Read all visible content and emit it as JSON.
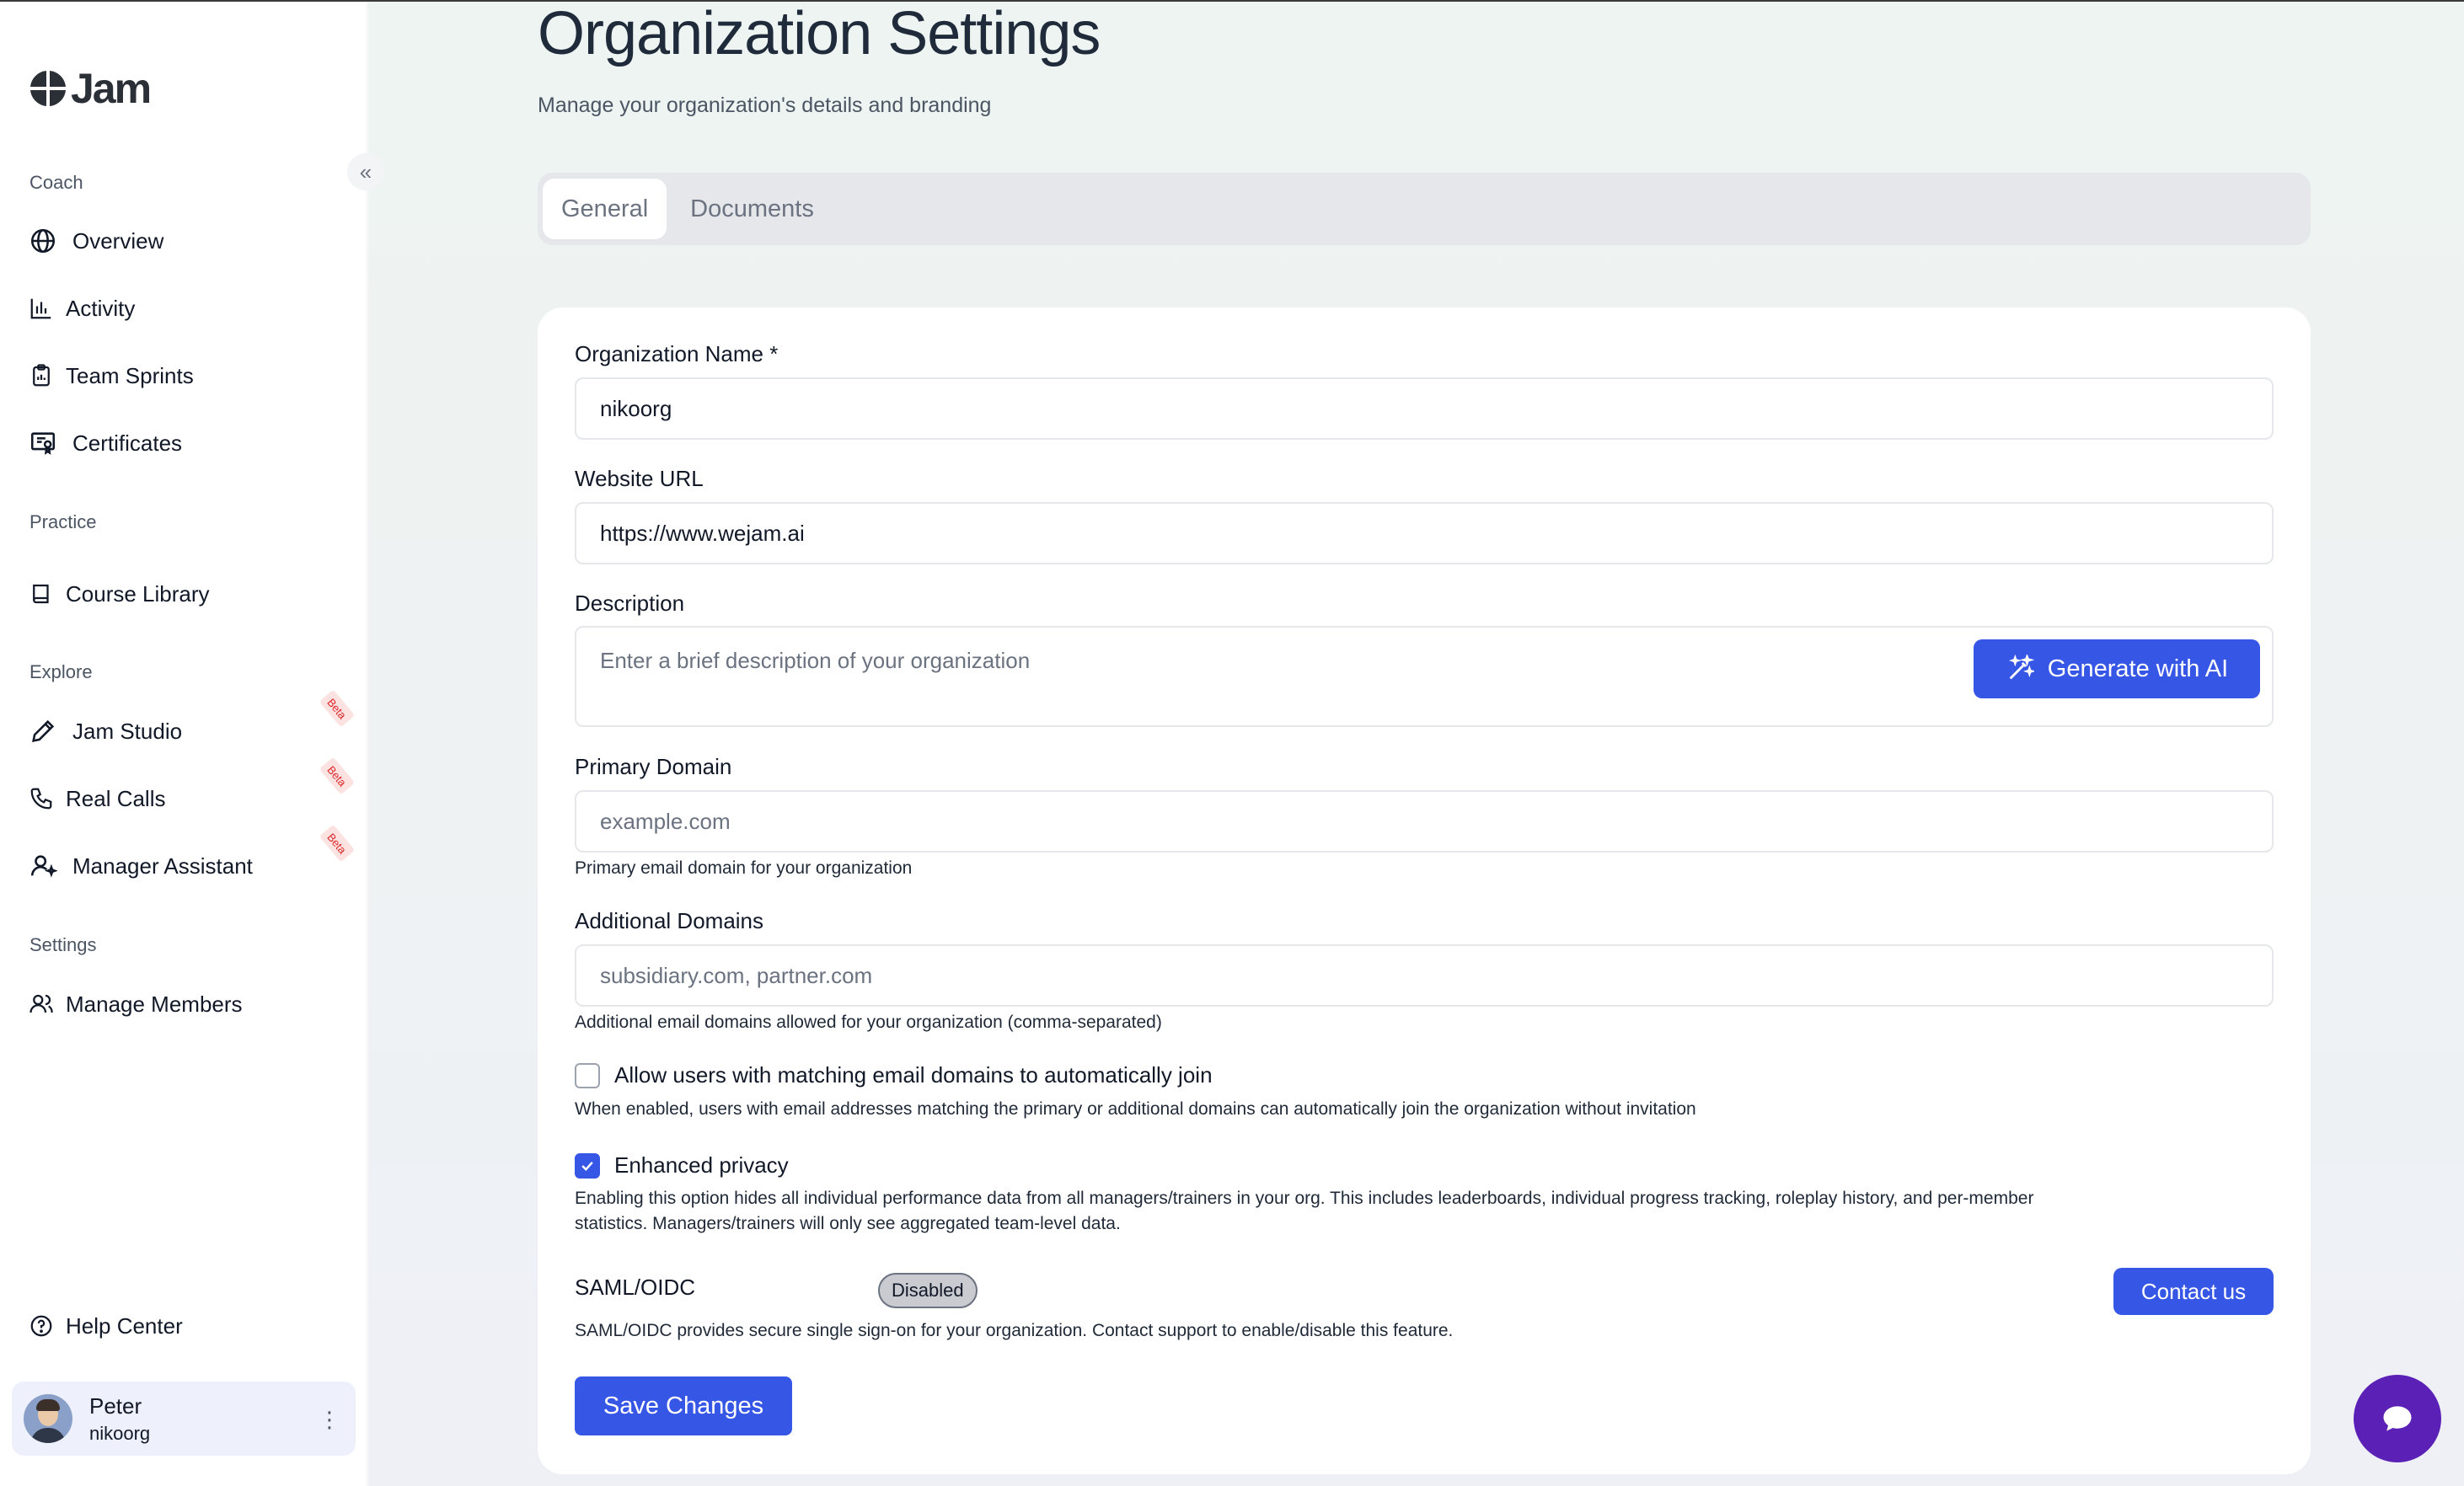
{
  "app": {
    "logo_text": "Jam"
  },
  "sidebar": {
    "sections": [
      {
        "label": "Coach",
        "items": [
          {
            "label": "Overview",
            "icon": "globe-icon"
          },
          {
            "label": "Activity",
            "icon": "bar-chart-icon"
          },
          {
            "label": "Team Sprints",
            "icon": "clipboard-icon"
          },
          {
            "label": "Certificates",
            "icon": "certificate-icon"
          }
        ]
      },
      {
        "label": "Practice",
        "items": [
          {
            "label": "Course Library",
            "icon": "book-icon"
          }
        ]
      },
      {
        "label": "Explore",
        "items": [
          {
            "label": "Jam Studio",
            "icon": "pencil-icon",
            "badge": "Beta"
          },
          {
            "label": "Real Calls",
            "icon": "phone-icon",
            "badge": "Beta"
          },
          {
            "label": "Manager Assistant",
            "icon": "user-sparkle-icon",
            "badge": "Beta"
          }
        ]
      },
      {
        "label": "Settings",
        "items": [
          {
            "label": "Manage Members",
            "icon": "users-icon"
          }
        ]
      }
    ],
    "help_center": "Help Center",
    "user": {
      "name": "Peter",
      "org": "nikoorg"
    }
  },
  "page": {
    "title": "Organization Settings",
    "subtitle": "Manage your organization's details and branding",
    "tabs": [
      {
        "label": "General",
        "active": true
      },
      {
        "label": "Documents",
        "active": false
      }
    ]
  },
  "form": {
    "org_name": {
      "label": "Organization Name *",
      "value": "nikoorg"
    },
    "website": {
      "label": "Website URL",
      "value": "https://www.wejam.ai"
    },
    "description": {
      "label": "Description",
      "placeholder": "Enter a brief description of your organization",
      "generate_label": "Generate with AI"
    },
    "primary_domain": {
      "label": "Primary Domain",
      "placeholder": "example.com",
      "help": "Primary email domain for your organization"
    },
    "additional_domains": {
      "label": "Additional Domains",
      "placeholder": "subsidiary.com, partner.com",
      "help": "Additional email domains allowed for your organization (comma-separated)"
    },
    "auto_join": {
      "label": "Allow users with matching email domains to automatically join",
      "checked": false,
      "help": "When enabled, users with email addresses matching the primary or additional domains can automatically join the organization without invitation"
    },
    "privacy": {
      "label": "Enhanced privacy",
      "checked": true,
      "help_line1": "Enabling this option hides all individual performance data from all managers/trainers in your org. This includes leaderboards, individual progress tracking, roleplay history, and per-member",
      "help_line2": "statistics. Managers/trainers will only see aggregated team-level data."
    },
    "saml": {
      "label": "SAML/OIDC",
      "status": "Disabled",
      "contact_label": "Contact us",
      "help": "SAML/OIDC provides secure single sign-on for your organization. Contact support to enable/disable this feature."
    },
    "save_label": "Save Changes"
  },
  "colors": {
    "accent": "#3656e6",
    "chat": "#5b21b6",
    "beta_bg": "#fde2e2",
    "beta_text": "#dc2626"
  }
}
